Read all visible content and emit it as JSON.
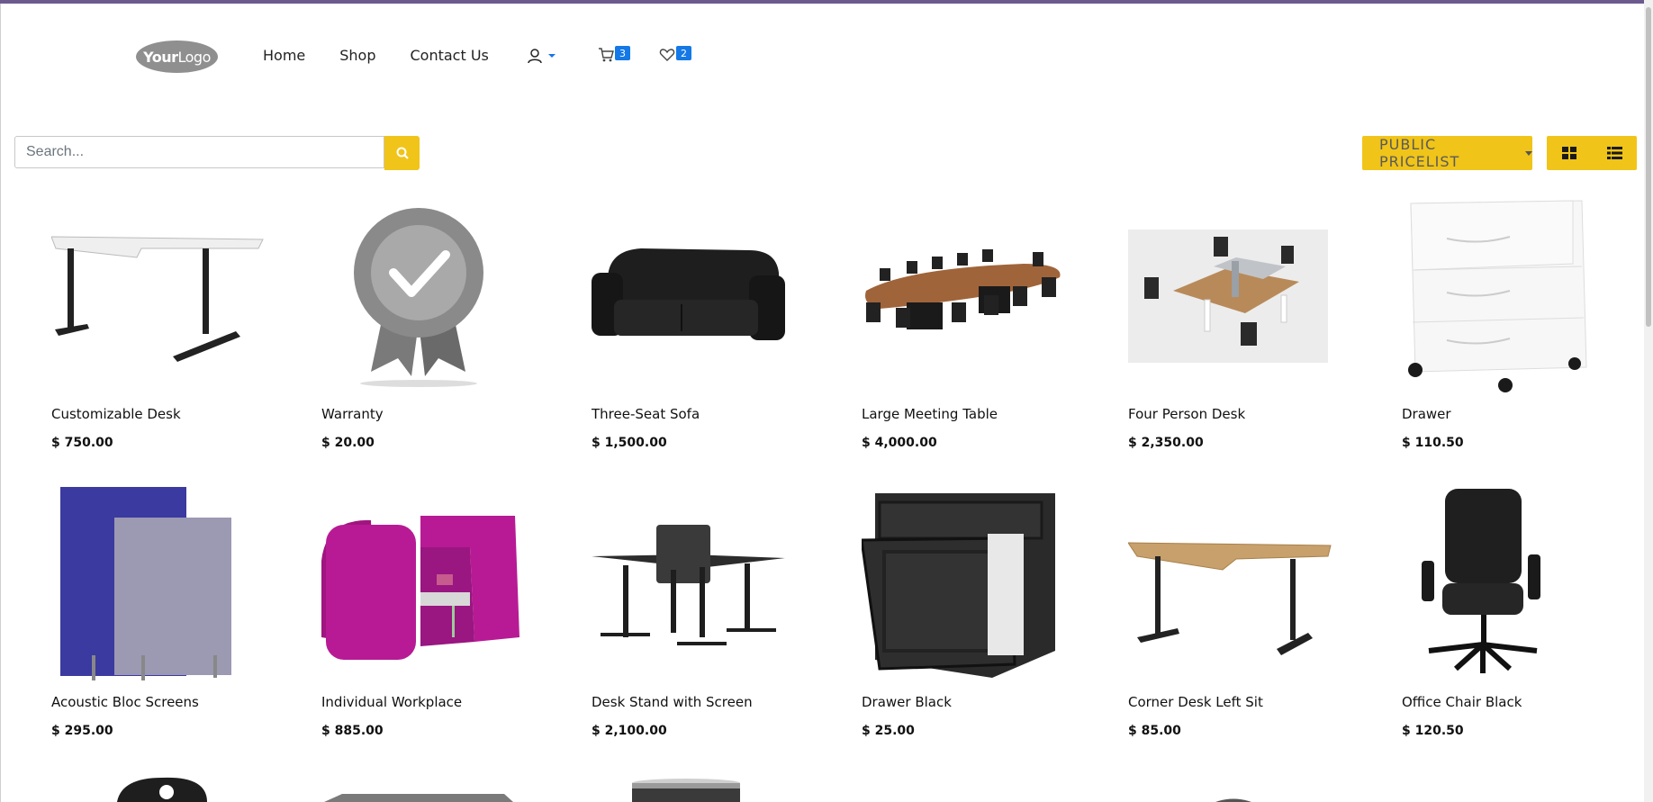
{
  "header": {
    "logo_text_bold": "Your",
    "logo_text": "Logo",
    "nav": [
      "Home",
      "Shop",
      "Contact Us"
    ],
    "cart_count": "3",
    "wishlist_count": "2"
  },
  "search": {
    "placeholder": "Search..."
  },
  "toolbar": {
    "pricelist_label": "PUBLIC PRICELIST"
  },
  "products": [
    {
      "name": "Customizable Desk",
      "price": "$ 750.00"
    },
    {
      "name": "Warranty",
      "price": "$ 20.00"
    },
    {
      "name": "Three-Seat Sofa",
      "price": "$ 1,500.00"
    },
    {
      "name": "Large Meeting Table",
      "price": "$ 4,000.00"
    },
    {
      "name": "Four Person Desk",
      "price": "$ 2,350.00"
    },
    {
      "name": "Drawer",
      "price": "$ 110.50"
    },
    {
      "name": "Acoustic Bloc Screens",
      "price": "$ 295.00"
    },
    {
      "name": "Individual Workplace",
      "price": "$ 885.00"
    },
    {
      "name": "Desk Stand with Screen",
      "price": "$ 2,100.00"
    },
    {
      "name": "Drawer Black",
      "price": "$ 25.00"
    },
    {
      "name": "Corner Desk Left Sit",
      "price": "$ 85.00"
    },
    {
      "name": "Office Chair Black",
      "price": "$ 120.50"
    }
  ],
  "colors": {
    "accent": "#f0c419",
    "badge": "#1478e6",
    "top_bar": "#6b5a8e"
  }
}
